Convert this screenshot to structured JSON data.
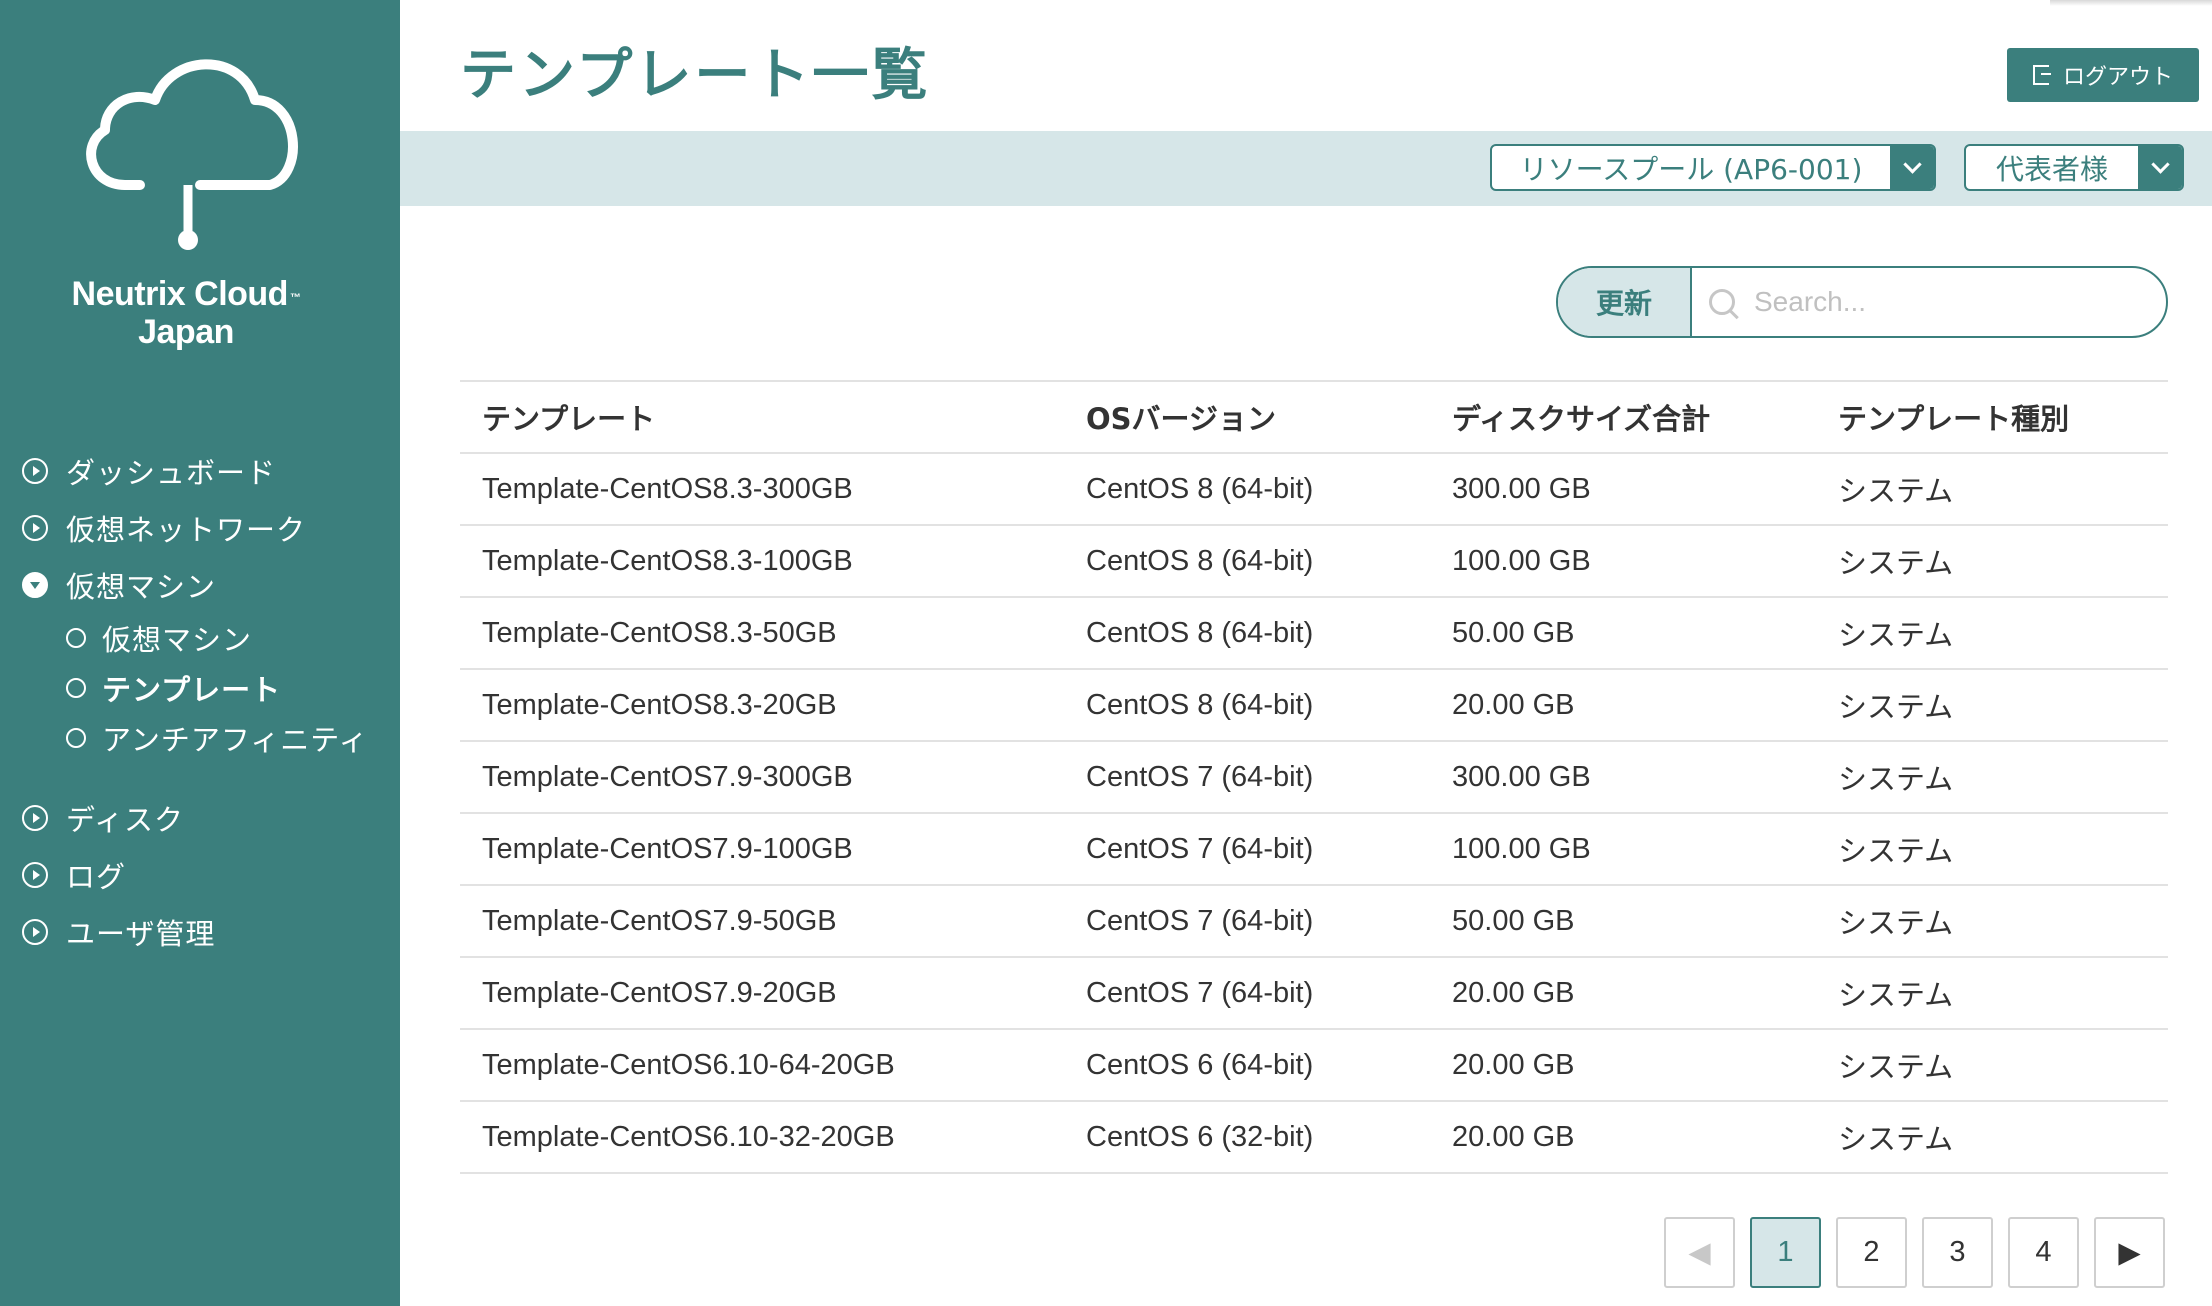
{
  "brand": {
    "line1": "Neutrix Cloud",
    "tm": "™",
    "line2": "Japan"
  },
  "sidebar": {
    "items": [
      {
        "label": "ダッシュボード"
      },
      {
        "label": "仮想ネットワーク"
      },
      {
        "label": "仮想マシン"
      }
    ],
    "subitems": [
      {
        "label": "仮想マシン"
      },
      {
        "label": "テンプレート"
      },
      {
        "label": "アンチアフィニティ"
      }
    ],
    "items2": [
      {
        "label": "ディスク"
      },
      {
        "label": "ログ"
      },
      {
        "label": "ユーザ管理"
      }
    ]
  },
  "header": {
    "title": "テンプレート一覧",
    "logout_label": "ログアウト",
    "resource_pool": "リソースプール (AP6-001)",
    "user": "代表者様"
  },
  "toolbar": {
    "refresh_label": "更新",
    "search_placeholder": "Search..."
  },
  "table": {
    "columns": [
      "テンプレート",
      "OSバージョン",
      "ディスクサイズ合計",
      "テンプレート種別"
    ],
    "rows": [
      [
        "Template-CentOS8.3-300GB",
        "CentOS 8 (64-bit)",
        "300.00 GB",
        "システム"
      ],
      [
        "Template-CentOS8.3-100GB",
        "CentOS 8 (64-bit)",
        "100.00 GB",
        "システム"
      ],
      [
        "Template-CentOS8.3-50GB",
        "CentOS 8 (64-bit)",
        "50.00 GB",
        "システム"
      ],
      [
        "Template-CentOS8.3-20GB",
        "CentOS 8 (64-bit)",
        "20.00 GB",
        "システム"
      ],
      [
        "Template-CentOS7.9-300GB",
        "CentOS 7 (64-bit)",
        "300.00 GB",
        "システム"
      ],
      [
        "Template-CentOS7.9-100GB",
        "CentOS 7 (64-bit)",
        "100.00 GB",
        "システム"
      ],
      [
        "Template-CentOS7.9-50GB",
        "CentOS 7 (64-bit)",
        "50.00 GB",
        "システム"
      ],
      [
        "Template-CentOS7.9-20GB",
        "CentOS 7 (64-bit)",
        "20.00 GB",
        "システム"
      ],
      [
        "Template-CentOS6.10-64-20GB",
        "CentOS 6 (64-bit)",
        "20.00 GB",
        "システム"
      ],
      [
        "Template-CentOS6.10-32-20GB",
        "CentOS 6 (32-bit)",
        "20.00 GB",
        "システム"
      ]
    ]
  },
  "pagination": {
    "prev": "◀",
    "pages": [
      "1",
      "2",
      "3",
      "4"
    ],
    "next": "▶",
    "current": "1"
  },
  "colors": {
    "primary": "#3b7f7d",
    "light": "#d6e6e8"
  }
}
